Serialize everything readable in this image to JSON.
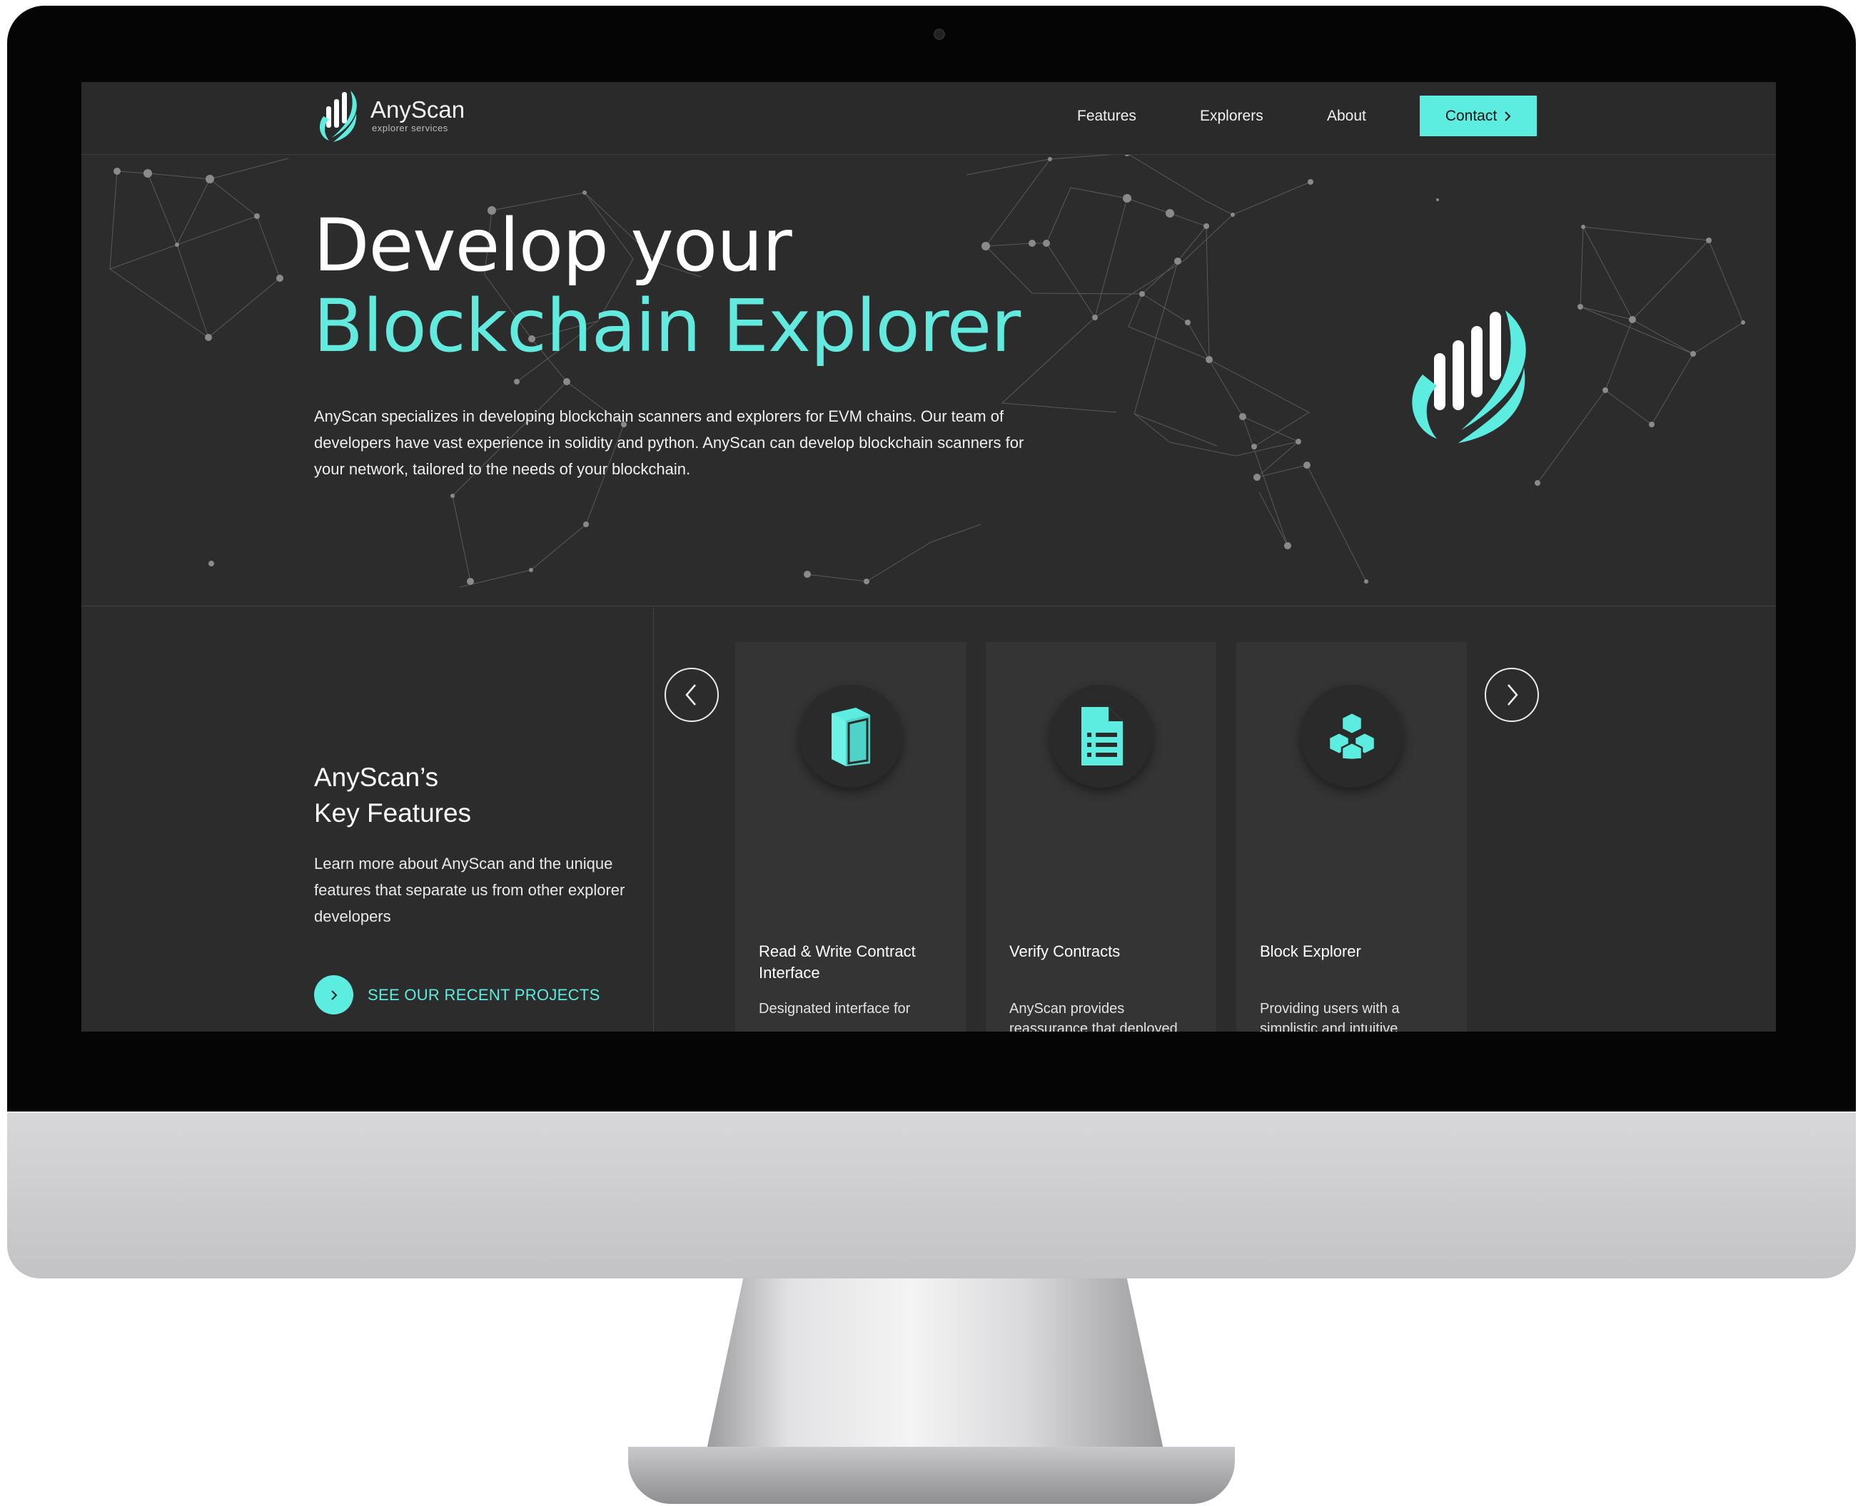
{
  "brand": {
    "name": "AnyScan",
    "tagline": "explorer services"
  },
  "nav": {
    "links": [
      "Features",
      "Explorers",
      "About"
    ],
    "contact_label": "Contact"
  },
  "hero": {
    "title_line1": "Develop your",
    "title_line2": "Blockchain Explorer",
    "description": "AnyScan specializes in developing blockchain scanners and explorers for EVM chains. Our team of developers have vast experience in solidity and python. AnyScan can develop blockchain scanners for your network, tailored to the needs of your blockchain."
  },
  "features": {
    "title_line1": "AnyScan’s",
    "title_line2": "Key Features",
    "description": "Learn more about AnyScan and the unique features that separate us from other explorer developers",
    "cta_label": "SEE OUR RECENT PROJECTS",
    "cards": [
      {
        "icon": "book-icon",
        "title": "Read & Write Contract Interface",
        "text": "Designated interface for"
      },
      {
        "icon": "document-list-icon",
        "title": "Verify Contracts",
        "text": "AnyScan provides reassurance that deployed"
      },
      {
        "icon": "cubes-icon",
        "title": "Block Explorer",
        "text": "Providing users with a simplistic and intuitive"
      }
    ]
  },
  "colors": {
    "accent": "#5cede0",
    "background": "#2c2c2c",
    "card": "#343434"
  }
}
